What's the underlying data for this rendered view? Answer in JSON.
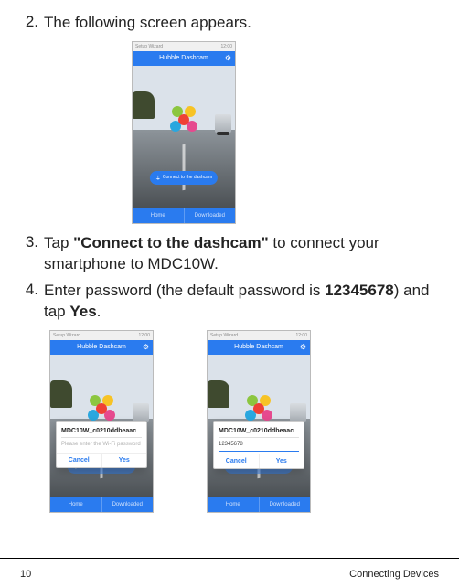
{
  "steps": {
    "s2": {
      "num": "2.",
      "text": "The following screen appears."
    },
    "s3": {
      "num": "3.",
      "lead": "Tap ",
      "bold": "\"Connect to the dashcam\"",
      "tail": " to connect your smartphone to MDC10W."
    },
    "s4": {
      "num": "4.",
      "lead": "Enter password (the default password is ",
      "bold": "12345678",
      "mid": ") and tap ",
      "bold2": "Yes",
      "tail": "."
    }
  },
  "phone": {
    "statusLeft": "Setup Wizard",
    "statusRight": "12:00",
    "appTitle": "Hubble Dashcam",
    "pill": "Connect to the dashcam",
    "tabHome": "Home",
    "tabDownloaded": "Downloaded"
  },
  "dialog": {
    "ssid": "MDC10W_c0210ddbeaac",
    "placeholder": "Please enter the Wi-Fi password",
    "filled": "12345678",
    "cancel": "Cancel",
    "yes": "Yes"
  },
  "footer": {
    "page": "10",
    "section": "Connecting Devices"
  }
}
